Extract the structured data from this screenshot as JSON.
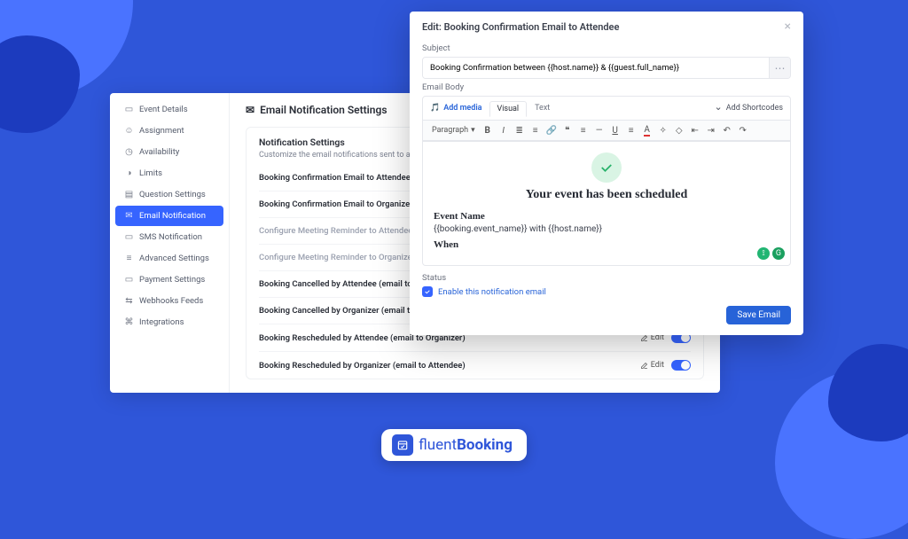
{
  "sidebar": {
    "items": [
      {
        "label": "Event Details"
      },
      {
        "label": "Assignment"
      },
      {
        "label": "Availability"
      },
      {
        "label": "Limits"
      },
      {
        "label": "Question Settings"
      },
      {
        "label": "Email Notification"
      },
      {
        "label": "SMS Notification"
      },
      {
        "label": "Advanced Settings"
      },
      {
        "label": "Payment Settings"
      },
      {
        "label": "Webhooks Feeds"
      },
      {
        "label": "Integrations"
      }
    ]
  },
  "main": {
    "heading": "Email Notification Settings",
    "subtitle": "Notification Settings",
    "subdesc": "Customize the email notifications sent to attendees and organizers",
    "edit_label": "Edit",
    "rows": [
      {
        "label": "Booking Confirmation Email to Attendee",
        "muted": false,
        "actions": false
      },
      {
        "label": "Booking Confirmation Email to Organizer (You)",
        "muted": false,
        "actions": false
      },
      {
        "label": "Configure Meeting Reminder to Attendee",
        "muted": true,
        "actions": false
      },
      {
        "label": "Configure Meeting Reminder to Organizer (You)",
        "muted": true,
        "actions": false
      },
      {
        "label": "Booking Cancelled by Attendee (email to Organizer)",
        "muted": false,
        "actions": false
      },
      {
        "label": "Booking Cancelled by Organizer (email to Attendee)",
        "muted": false,
        "actions": false
      },
      {
        "label": "Booking Rescheduled by Attendee (email to Organizer)",
        "muted": false,
        "actions": true
      },
      {
        "label": "Booking Rescheduled by Organizer (email to Attendee)",
        "muted": false,
        "actions": true
      }
    ]
  },
  "modal": {
    "title": "Edit: Booking Confirmation Email to Attendee",
    "subject_label": "Subject",
    "subject_value": "Booking Confirmation between {{host.name}} & {{guest.full_name}}",
    "body_label": "Email Body",
    "add_media": "Add media",
    "tab_visual": "Visual",
    "tab_text": "Text",
    "shortcodes": "Add Shortcodes",
    "paragraph": "Paragraph",
    "headline": "Your event has been scheduled",
    "event_name_label": "Event Name",
    "event_name_value": "{{booking.event_name}} with {{host.name}}",
    "when_label": "When",
    "status_label": "Status",
    "enable_label": "Enable this notification email",
    "save_label": "Save Email"
  },
  "brand": {
    "name_a": "fluent",
    "name_b": "Booking"
  }
}
